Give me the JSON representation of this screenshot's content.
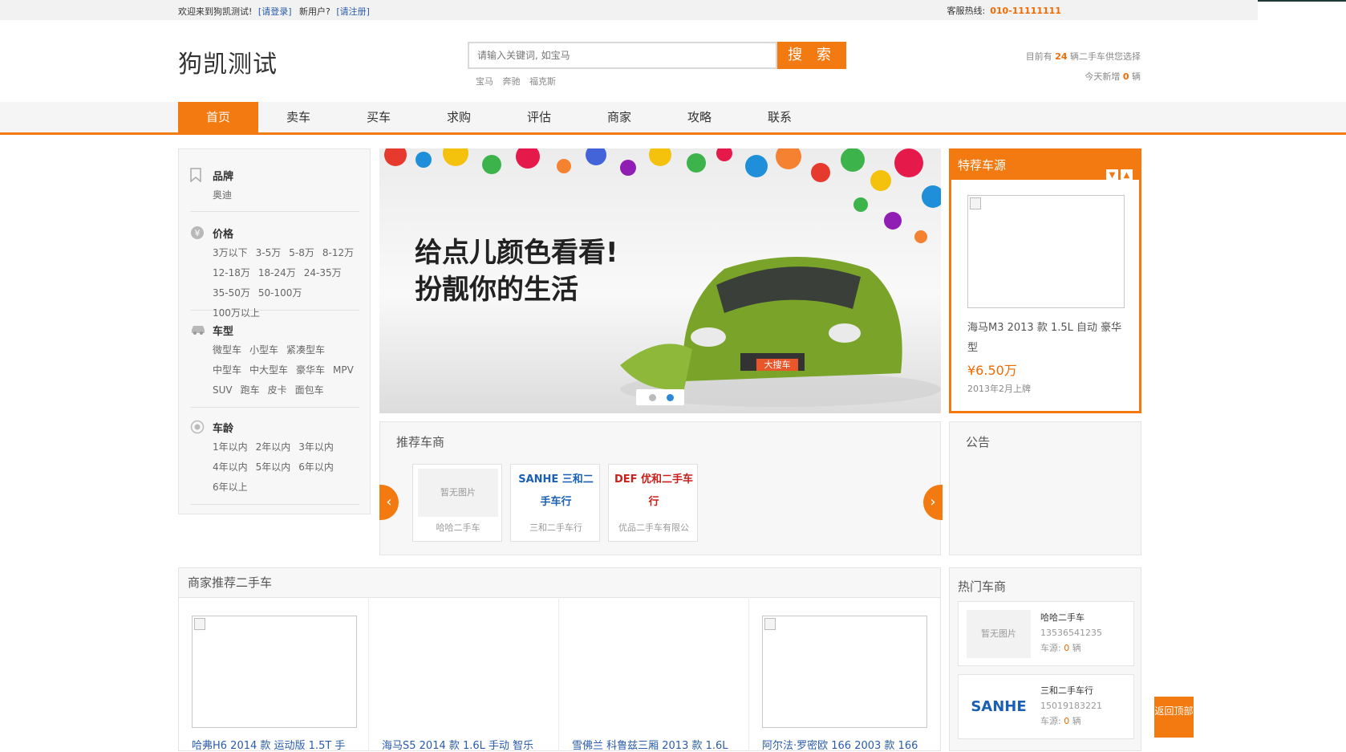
{
  "topbar": {
    "welcome": "欢迎来到狗凯测试!",
    "login_link": "[请登录]",
    "new_user": "新用户?",
    "register_link": "[请注册]",
    "hotline_label": "客服热线:",
    "hotline_number": "010-11111111"
  },
  "header": {
    "logo": "狗凯测试",
    "search_placeholder": "请输入关键词, 如宝马",
    "search_button": "搜 索",
    "hot_keywords": [
      "宝马",
      "奔驰",
      "福克斯"
    ],
    "stats_line1_prefix": "目前有",
    "stats_line1_count": "24",
    "stats_line1_suffix": "辆二手车供您选择",
    "stats_line2_prefix": "今天新增",
    "stats_line2_count": "0",
    "stats_line2_suffix": "辆"
  },
  "nav": {
    "items": [
      "首页",
      "卖车",
      "买车",
      "求购",
      "评估",
      "商家",
      "攻略",
      "联系"
    ],
    "active_index": 0
  },
  "filters": {
    "brand": {
      "title": "品牌",
      "options": [
        "奥迪"
      ]
    },
    "price": {
      "title": "价格",
      "options": [
        "3万以下",
        "3-5万",
        "5-8万",
        "8-12万",
        "12-18万",
        "18-24万",
        "24-35万",
        "35-50万",
        "50-100万",
        "100万以上"
      ]
    },
    "type": {
      "title": "车型",
      "options": [
        "微型车",
        "小型车",
        "紧凑型车",
        "中型车",
        "中大型车",
        "豪华车",
        "MPV",
        "SUV",
        "跑车",
        "皮卡",
        "面包车"
      ]
    },
    "age": {
      "title": "车龄",
      "options": [
        "1年以内",
        "2年以内",
        "3年以内",
        "4年以内",
        "5年以内",
        "6年以内",
        "6年以上"
      ]
    }
  },
  "banner": {
    "line1": "给点儿颜色看看!",
    "line2": "扮靓你的生活",
    "plate": "大搜车",
    "slide_count": 2,
    "active_slide": 1
  },
  "featured": {
    "title": "特荐车源",
    "car_title": "海马M3 2013 款 1.5L 自动 豪华型",
    "price": "¥6.50万",
    "date": "2013年2月上牌"
  },
  "dealers": {
    "title": "推荐车商",
    "items": [
      {
        "name": "哈哈二手车",
        "pic": "暂无图片"
      },
      {
        "name": "三和二手车行",
        "pic": "SANHE 三和二手车行"
      },
      {
        "name": "优品二手车有限公",
        "pic": "DEF 优和二手车行"
      }
    ]
  },
  "notice": {
    "title": "公告"
  },
  "recommended": {
    "title": "商家推荐二手车",
    "cars": [
      "哈弗H6 2014 款 运动版 1.5T 手",
      "海马S5 2014 款 1.6L 手动 智乐",
      "雪佛兰 科鲁兹三厢 2013 款 1.6L",
      "阿尔法·罗密欧 166 2003 款 166"
    ]
  },
  "hot_dealers": {
    "title": "热门车商",
    "items": [
      {
        "name": "哈哈二手车",
        "phone": "13536541235",
        "stock_label": "车源:",
        "stock": "0",
        "unit": "辆",
        "pic": "暂无图片"
      },
      {
        "name": "三和二手车行",
        "phone": "15019183221",
        "stock_label": "车源:",
        "stock": "0",
        "unit": "辆",
        "pic": "SANHE"
      }
    ]
  },
  "back_to_top": "返回顶部",
  "colors": {
    "accent": "#f37a10",
    "link": "#2a5caa"
  }
}
